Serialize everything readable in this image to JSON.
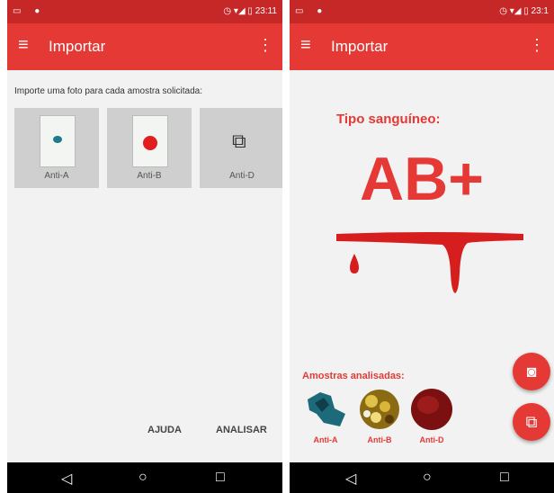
{
  "left_screen": {
    "status": {
      "icons": "▭ ●",
      "time": "23:11",
      "right_icons": "◷ ▾◢ ▯"
    },
    "appbar": {
      "menu_icon": "≡",
      "title": "Importar",
      "more_icon": "⋮"
    },
    "instruction": "Importe uma foto para cada amostra solicitada:",
    "tiles": [
      {
        "label": "Anti-A"
      },
      {
        "label": "Anti-B"
      },
      {
        "label": "Anti-D"
      }
    ],
    "actions": {
      "help": "AJUDA",
      "analyze": "ANALISAR"
    }
  },
  "right_screen": {
    "status": {
      "icons": "▭ ●",
      "time": "23:1",
      "right_icons": "◷ ▾◢ ▯"
    },
    "appbar": {
      "menu_icon": "≡",
      "title": "Importar",
      "more_icon": "⋮"
    },
    "blood_type_title": "Tipo sanguíneo:",
    "blood_type_value": "AB+",
    "samples_title": "Amostras analisadas:",
    "samples": [
      {
        "label": "Anti-A"
      },
      {
        "label": "Anti-B"
      },
      {
        "label": "Anti-D"
      }
    ]
  },
  "navbar": {
    "back": "◁",
    "home": "○",
    "recents": "□"
  },
  "colors": {
    "primary": "#e53935",
    "status": "#c62828",
    "background": "#f2f2f2"
  }
}
